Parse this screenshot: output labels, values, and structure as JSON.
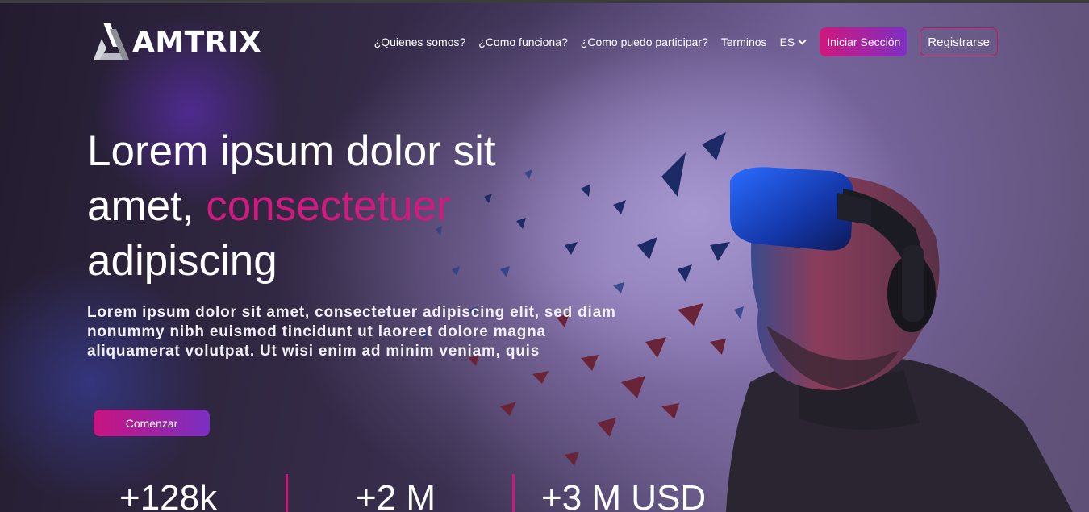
{
  "brand": {
    "name": "AMTRIX"
  },
  "nav": {
    "links": [
      "¿Quienes somos?",
      "¿Como funciona?",
      "¿Como puedo participar?",
      "Terminos"
    ],
    "language": "ES",
    "login_label": "Iniciar Sección",
    "register_label": "Registrarse"
  },
  "hero": {
    "headline_part1": "Lorem ipsum dolor sit amet,",
    "headline_accent": "consectetuer",
    "headline_part2": "adipiscing",
    "lead": "Lorem ipsum dolor sit amet, consectetuer adipiscing elit, sed diam nonummy nibh euismod tincidunt ut laoreet dolore magna aliquamerat volutpat. Ut wisi enim ad minim veniam, quis",
    "cta_label": "Comenzar"
  },
  "stats": [
    "+128k",
    "+2 M",
    "+3 M USD"
  ],
  "colors": {
    "accent": "#cf1a7e",
    "gradient_start": "#d0177c",
    "gradient_end": "#7e2fc4"
  },
  "icons": {
    "logo": "amtrix-logo-icon",
    "language_toggle": "chevron-down-icon"
  }
}
